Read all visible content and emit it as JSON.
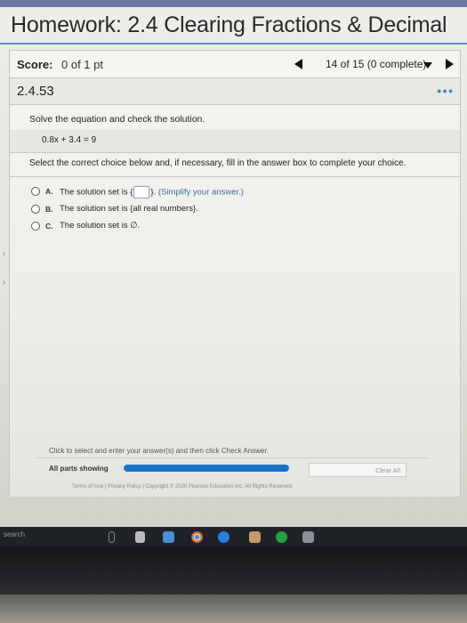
{
  "header": {
    "title": "Homework: 2.4 Clearing Fractions & Decimal"
  },
  "score_bar": {
    "score_label": "Score:",
    "score_value": "0 of 1 pt",
    "progress": "14 of 15 (0 complete)"
  },
  "section": {
    "number": "2.4.53"
  },
  "question": {
    "instruction": "Solve the equation and check the solution.",
    "equation": "0.8x + 3.4 = 9",
    "prompt": "Select the correct choice below and, if necessary, fill in the answer box to complete your choice.",
    "choices": [
      {
        "letter": "A.",
        "text_before": "The solution set is {",
        "text_after": "}.",
        "hint": "(Simplify your answer.)"
      },
      {
        "letter": "B.",
        "text": "The solution set is {all real numbers}."
      },
      {
        "letter": "C.",
        "text": "The solution set is ∅."
      }
    ]
  },
  "footer": {
    "check_note": "Click to select and enter your answer(s) and then click Check Answer.",
    "parts_label": "All parts showing",
    "parts_progress": 1.0,
    "clear_all_label": "Clear All",
    "terms": "Terms of Use | Privacy Policy | Copyright © 2020 Pearson Education Inc. All Rights Reserved."
  },
  "taskbar": {
    "search_text": "search"
  },
  "colors": {
    "accent": "#1a73c8",
    "title_rule": "#5a8fc8",
    "taskbar": "#1f2227"
  },
  "icons": [
    "prev-arrow-icon",
    "dropdown-caret-icon",
    "next-arrow-icon",
    "microphone-icon",
    "task-view-icon",
    "mail-icon",
    "chrome-icon",
    "edge-icon",
    "paint-icon",
    "green-app-icon",
    "store-icon"
  ]
}
